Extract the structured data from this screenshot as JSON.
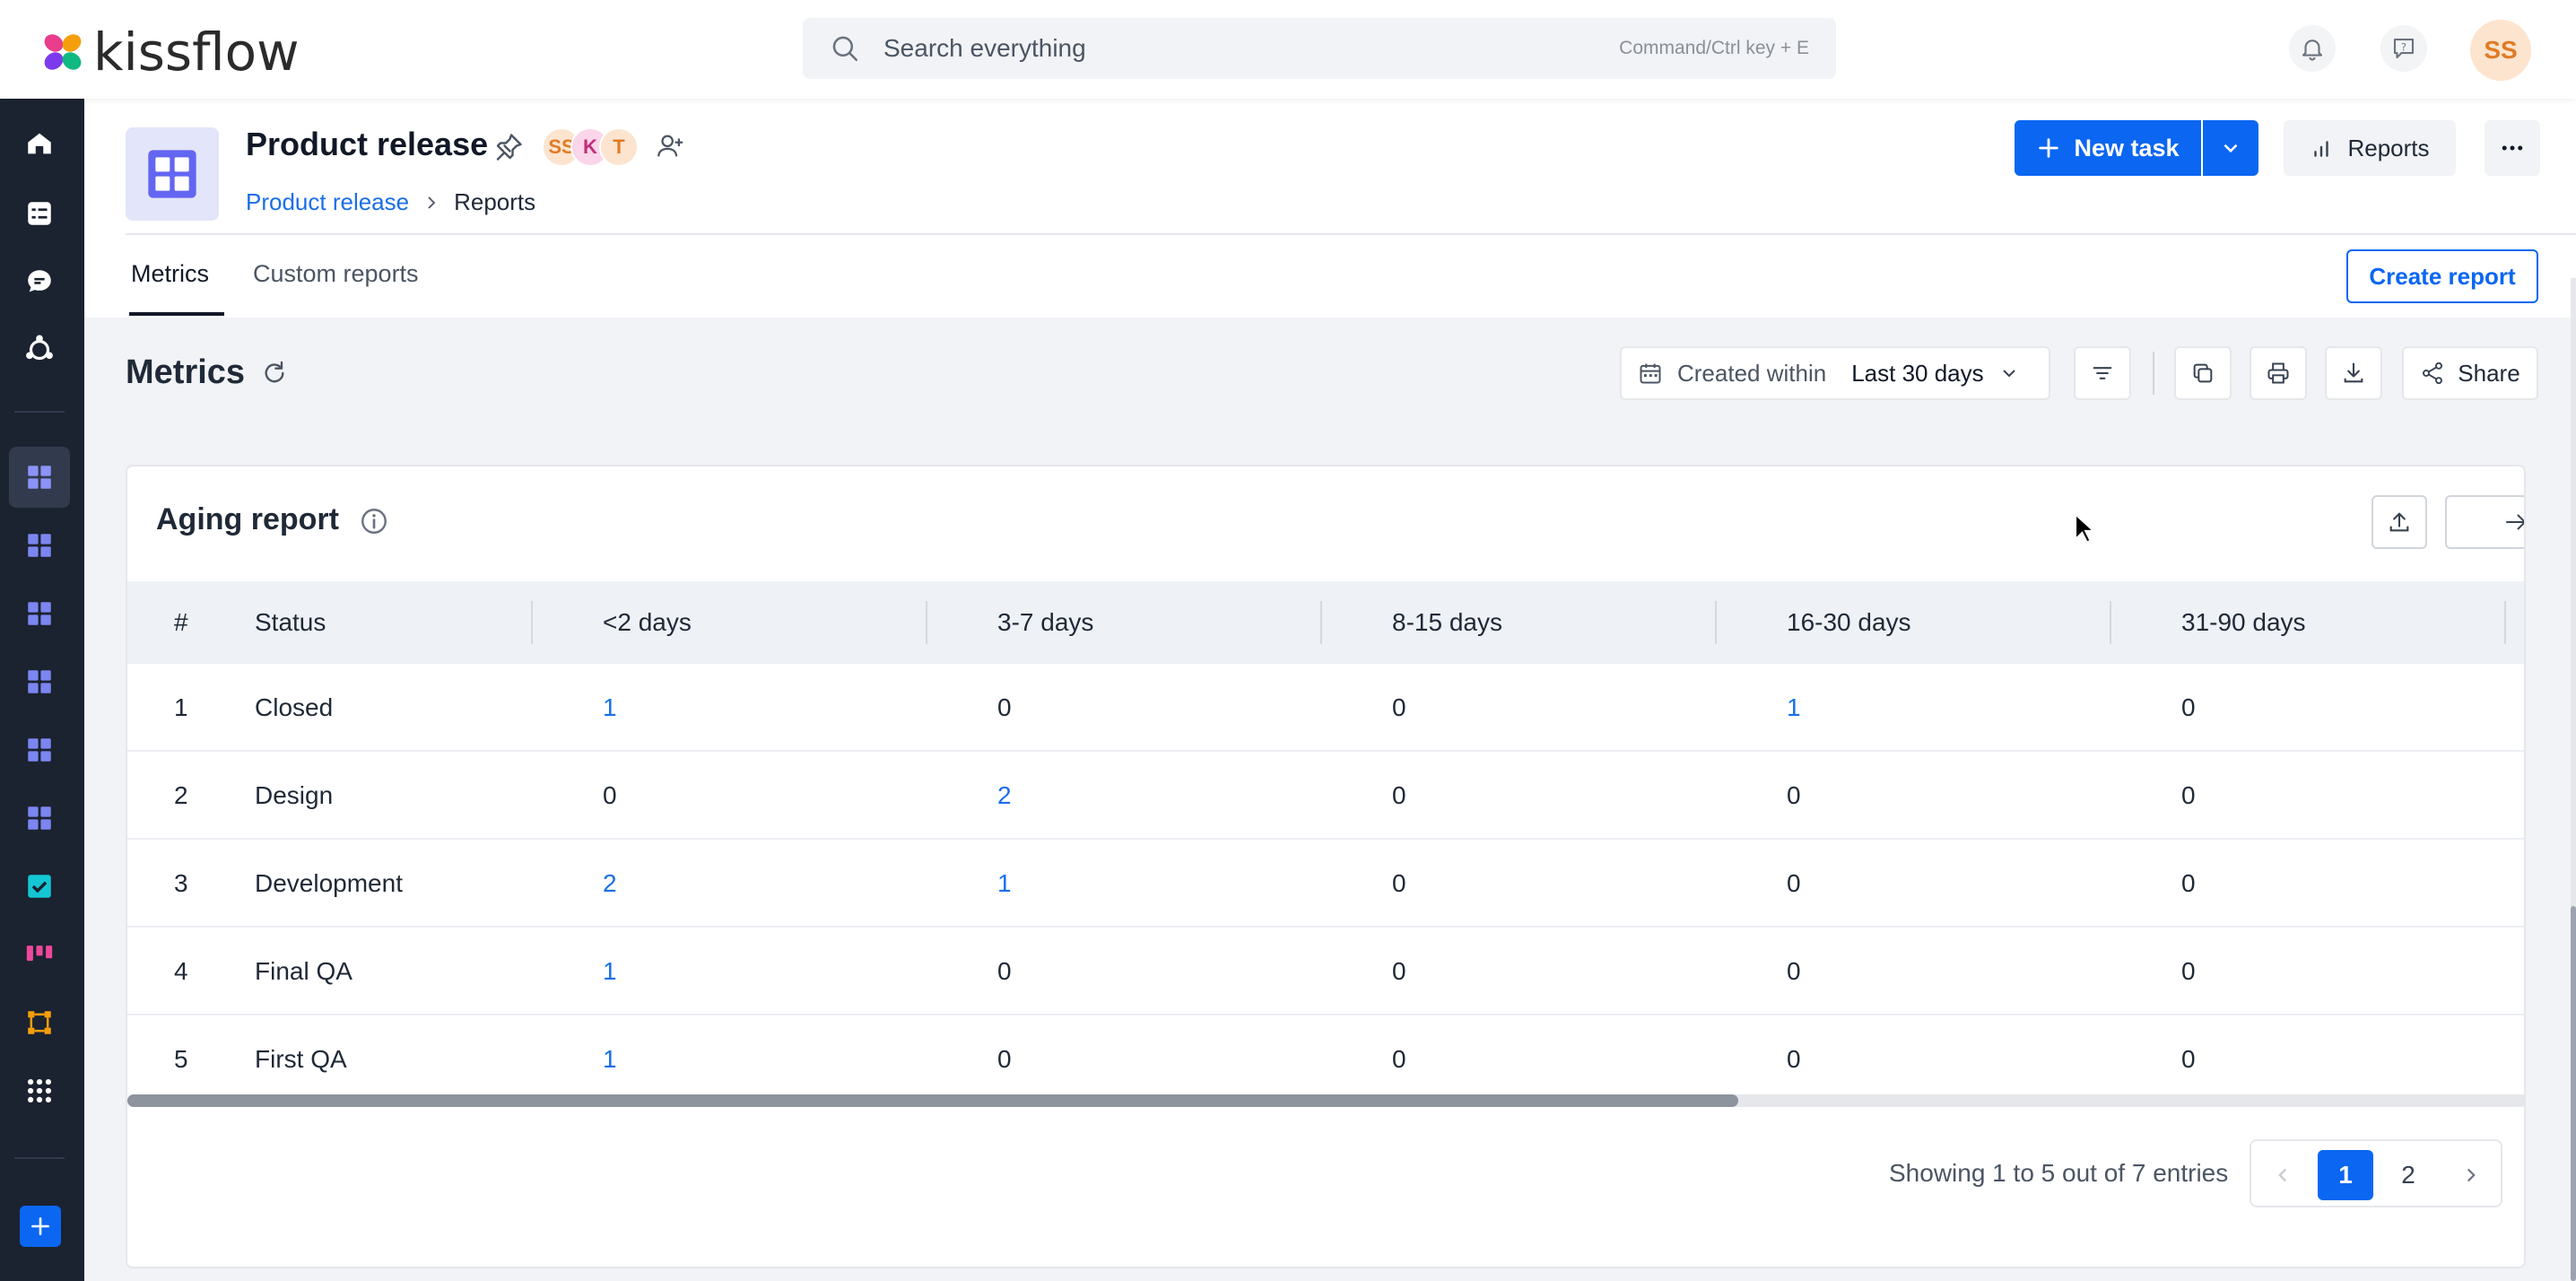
{
  "topbar": {
    "logo_text": "kissflow",
    "search_placeholder": "Search everything",
    "search_hint": "Command/Ctrl key + E",
    "user_initials": "SS"
  },
  "header": {
    "project_title": "Product release",
    "members": [
      "SS",
      "K",
      "T"
    ],
    "breadcrumb": [
      "Product release",
      "Reports"
    ],
    "new_task_label": "New task",
    "reports_label": "Reports"
  },
  "tabs": [
    {
      "label": "Metrics",
      "active": true
    },
    {
      "label": "Custom reports",
      "active": false
    }
  ],
  "create_report_label": "Create report",
  "metrics": {
    "title": "Metrics",
    "filter_label": "Created within",
    "filter_value": "Last 30 days",
    "share_label": "Share"
  },
  "aging_report": {
    "title": "Aging report",
    "columns": [
      "#",
      "Status",
      "<2 days",
      "3-7 days",
      "8-15 days",
      "16-30 days",
      "31-90 days"
    ],
    "rows": [
      {
        "num": "1",
        "status": "Closed",
        "lt2": "1",
        "d3_7": "0",
        "d8_15": "0",
        "d16_30": "1",
        "d31_90": "0"
      },
      {
        "num": "2",
        "status": "Design",
        "lt2": "0",
        "d3_7": "2",
        "d8_15": "0",
        "d16_30": "0",
        "d31_90": "0"
      },
      {
        "num": "3",
        "status": "Development",
        "lt2": "2",
        "d3_7": "1",
        "d8_15": "0",
        "d16_30": "0",
        "d31_90": "0"
      },
      {
        "num": "4",
        "status": "Final QA",
        "lt2": "1",
        "d3_7": "0",
        "d8_15": "0",
        "d16_30": "0",
        "d31_90": "0"
      },
      {
        "num": "5",
        "status": "First QA",
        "lt2": "1",
        "d3_7": "0",
        "d8_15": "0",
        "d16_30": "0",
        "d31_90": "0"
      }
    ],
    "entries_text": "Showing 1 to 5 out of 7 entries",
    "pages": [
      "1",
      "2"
    ],
    "current_page": "1"
  },
  "colors": {
    "accent": "#0b66f2",
    "link": "#1a6fe8",
    "sidebar": "#1b2230"
  }
}
